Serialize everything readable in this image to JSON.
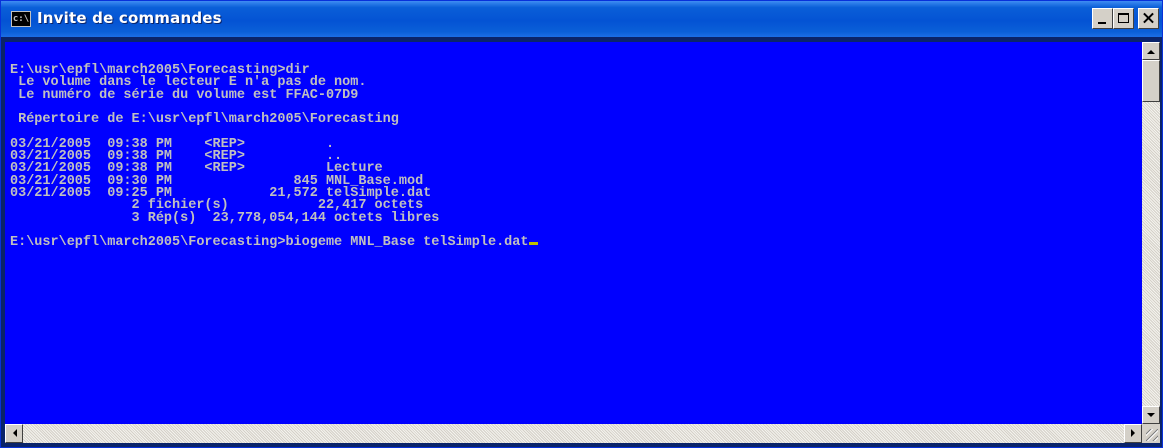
{
  "window": {
    "title": "Invite de commandes",
    "icon": "cmd-icon",
    "icon_text": "c:\\"
  },
  "console": {
    "lines": [
      "E:\\usr\\epfl\\march2005\\Forecasting>dir",
      " Le volume dans le lecteur E n'a pas de nom.",
      " Le numéro de série du volume est FFAC-07D9",
      "",
      " Répertoire de E:\\usr\\epfl\\march2005\\Forecasting",
      "",
      "03/21/2005  09:38 PM    <REP>          .",
      "03/21/2005  09:38 PM    <REP>          ..",
      "03/21/2005  09:38 PM    <REP>          Lecture",
      "03/21/2005  09:30 PM               845 MNL_Base.mod",
      "03/21/2005  09:25 PM            21,572 telSimple.dat",
      "               2 fichier(s)           22,417 octets",
      "               3 Rép(s)  23,778,054,144 octets libres",
      "",
      "E:\\usr\\epfl\\march2005\\Forecasting>biogeme MNL_Base telSimple.dat"
    ]
  },
  "colors": {
    "console_background": "#0000ff",
    "console_text": "#c0c0c0",
    "cursor": "#c0c000",
    "titlebar": "#0453d4"
  }
}
